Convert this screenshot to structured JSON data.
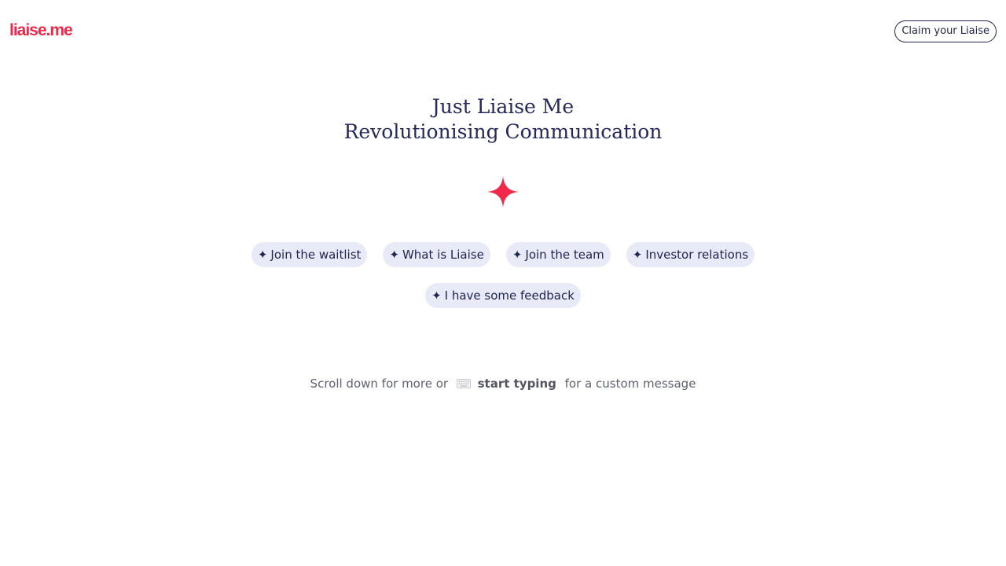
{
  "header": {
    "logo_text": "liaise.me",
    "claim_button_label": "Claim your Liaise"
  },
  "hero": {
    "title_line_1": "Just Liaise Me",
    "title_line_2": "Revolutionising Communication",
    "sparkle_icon": "sparkle-icon",
    "sparkle_color": "#f0284a"
  },
  "chips": [
    {
      "icon": "sparkle-small-icon",
      "glyph": "✦",
      "label": "Join the waitlist"
    },
    {
      "icon": "sparkle-small-icon",
      "glyph": "✦",
      "label": "What is Liaise"
    },
    {
      "icon": "sparkle-small-icon",
      "glyph": "✦",
      "label": "Join the team"
    },
    {
      "icon": "sparkle-small-icon",
      "glyph": "✦",
      "label": "Investor relations"
    },
    {
      "icon": "sparkle-small-icon",
      "glyph": "✦",
      "label": "I have some feedback"
    }
  ],
  "footer_hint": {
    "prefix": "Scroll down for more or",
    "icon": "keyboard-icon",
    "emphasis": "start typing",
    "suffix": "for a custom message"
  },
  "colors": {
    "brand": "#f0284a",
    "text": "#22254f",
    "chip_background": "#e8eaf7"
  }
}
